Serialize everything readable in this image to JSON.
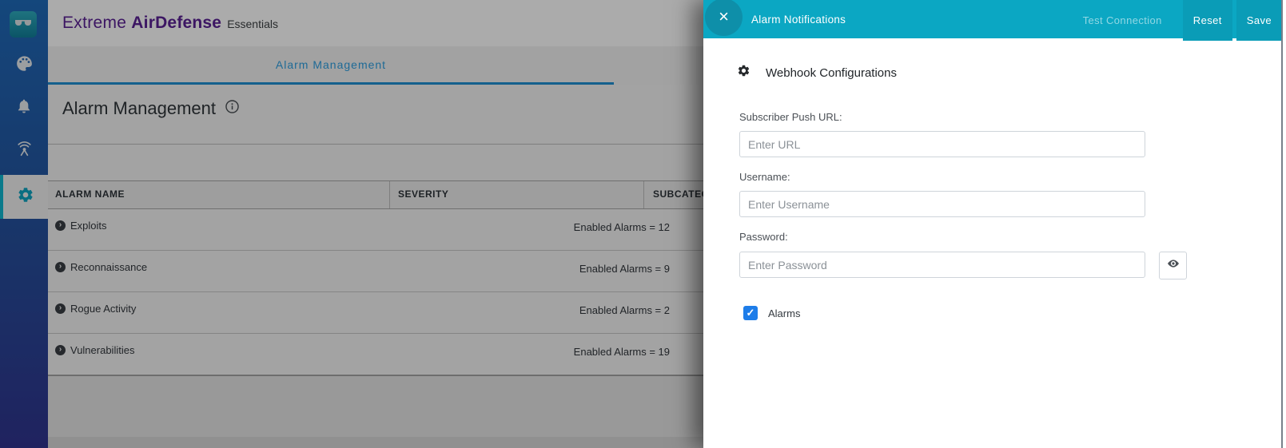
{
  "header": {
    "brand_extreme": "Extreme",
    "brand_product": "AirDefense",
    "brand_edition": "Essentials"
  },
  "tabs": [
    {
      "label": "Alarm Management",
      "active": true
    }
  ],
  "page": {
    "title": "Alarm Management",
    "table": {
      "columns": [
        "ALARM NAME",
        "SEVERITY",
        "SUBCATEGORY"
      ],
      "rows": [
        {
          "name": "Exploits",
          "enabled": "Enabled Alarms = 12"
        },
        {
          "name": "Reconnaissance",
          "enabled": "Enabled Alarms = 9"
        },
        {
          "name": "Rogue Activity",
          "enabled": "Enabled Alarms = 2"
        },
        {
          "name": "Vulnerabilities",
          "enabled": "Enabled Alarms = 19"
        }
      ]
    }
  },
  "sidebar": {
    "icons": [
      "airdefense-logo",
      "palette-icon",
      "bell-icon",
      "wireless-icon",
      "gear-icon"
    ],
    "active_item": "settings"
  },
  "panel": {
    "title": "Alarm Notifications",
    "actions": {
      "test": "Test Connection",
      "reset": "Reset",
      "save": "Save"
    },
    "section_title": "Webhook Configurations",
    "fields": [
      {
        "label": "Subscriber Push URL:",
        "placeholder": "Enter URL"
      },
      {
        "label": "Username:",
        "placeholder": "Enter Username"
      },
      {
        "label": "Password:",
        "placeholder": "Enter Password"
      }
    ],
    "alarms_checkbox": {
      "label": "Alarms",
      "checked": true
    }
  },
  "colors": {
    "accent_teal": "#0ba7c3",
    "panel_button_teal": "#0a9cb7",
    "brand_purple": "#5a2194",
    "tab_blue": "#2e9fe0",
    "checkbox_blue": "#1e7de9"
  }
}
